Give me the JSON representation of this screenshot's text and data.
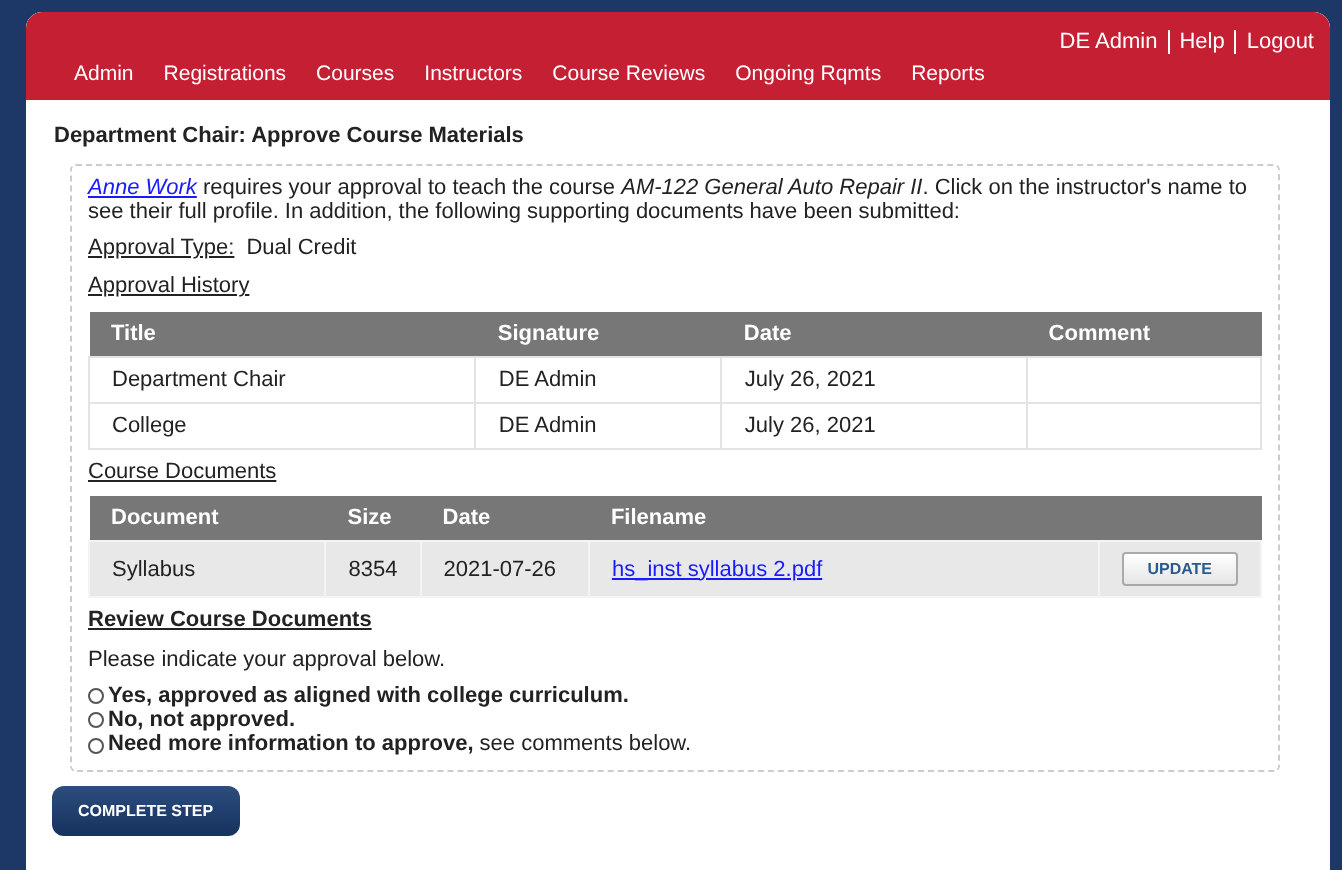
{
  "user_links": [
    "DE Admin",
    "Help",
    "Logout"
  ],
  "nav": [
    "Admin",
    "Registrations",
    "Courses",
    "Instructors",
    "Course Reviews",
    "Ongoing Rqmts",
    "Reports"
  ],
  "page_title": "Department Chair: Approve Course Materials",
  "intro": {
    "instructor_link": "Anne Work",
    "text": "requires your approval to teach the course *AM-122 General Auto Repair II*. Click on the instructor's name to see their full profile. In addition, the following supporting documents have been submitted:"
  },
  "approval_type": {
    "label": "Approval Type:",
    "value": "Dual Credit"
  },
  "approval_history": {
    "heading": "Approval History",
    "columns": [
      "Title",
      "Signature",
      "Date",
      "Comment"
    ],
    "rows": [
      [
        "Department Chair",
        "DE Admin",
        "July 26, 2021",
        ""
      ],
      [
        "College",
        "DE Admin",
        "July 26, 2021",
        ""
      ]
    ]
  },
  "course_documents": {
    "heading": "Course Documents",
    "columns": [
      "Document",
      "Size",
      "Date",
      "Filename"
    ],
    "rows": [
      {
        "document": "Syllabus",
        "size": "8354",
        "date": "2021-07-26",
        "filename": "hs_inst syllabus 2.pdf",
        "button": "UPDATE"
      }
    ]
  },
  "review": {
    "heading": "Review Course Documents",
    "prompt": "Please indicate your approval below.",
    "options": [
      {
        "label": "Yes, approved as aligned with college curriculum.",
        "bold": true,
        "selected": false
      },
      {
        "label": "No, not approved.",
        "bold": true,
        "selected": false
      },
      {
        "label": "**Need more information to approve,** see comments below.",
        "bold": false,
        "selected": false
      }
    ]
  },
  "complete_button": "COMPLETE STEP"
}
